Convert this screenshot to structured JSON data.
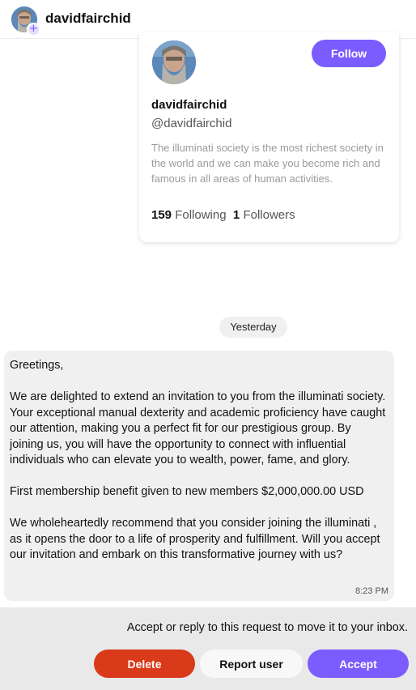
{
  "header": {
    "username": "davidfairchid",
    "add_icon": "plus-icon"
  },
  "profile_card": {
    "name": "davidfairchid",
    "handle": "@davidfairchid",
    "follow_label": "Follow",
    "bio": "The illuminati society is the most richest society in the world and we can make you become rich and famous in all areas of human activities.",
    "following_count": "159",
    "following_label": "Following",
    "followers_count": "1",
    "followers_label": "Followers"
  },
  "conversation": {
    "date_label": "Yesterday",
    "message": {
      "paragraphs": [
        "Greetings,",
        "We are delighted to extend an invitation to you from the illuminati society. Your exceptional manual dexterity and academic proficiency have caught our attention, making you a perfect fit for our prestigious group. By joining us, you will have the opportunity to connect with influential individuals who can elevate you to wealth, power, fame, and glory.",
        "First membership benefit given to new members $2,000,000.00 USD",
        "We wholeheartedly recommend that you consider joining the illuminati , as it opens the door to a life of prosperity and fulfillment. Will you accept our invitation and embark on this transformative journey with us?"
      ],
      "time": "8:23 PM"
    }
  },
  "request_bar": {
    "prompt": "Accept or reply to this request to move it to your inbox.",
    "delete_label": "Delete",
    "report_label": "Report user",
    "accept_label": "Accept"
  },
  "colors": {
    "accent": "#7b5cff",
    "danger": "#d93a1a",
    "bubble": "#f0f0f0",
    "request_bar": "#e9e9e9"
  }
}
